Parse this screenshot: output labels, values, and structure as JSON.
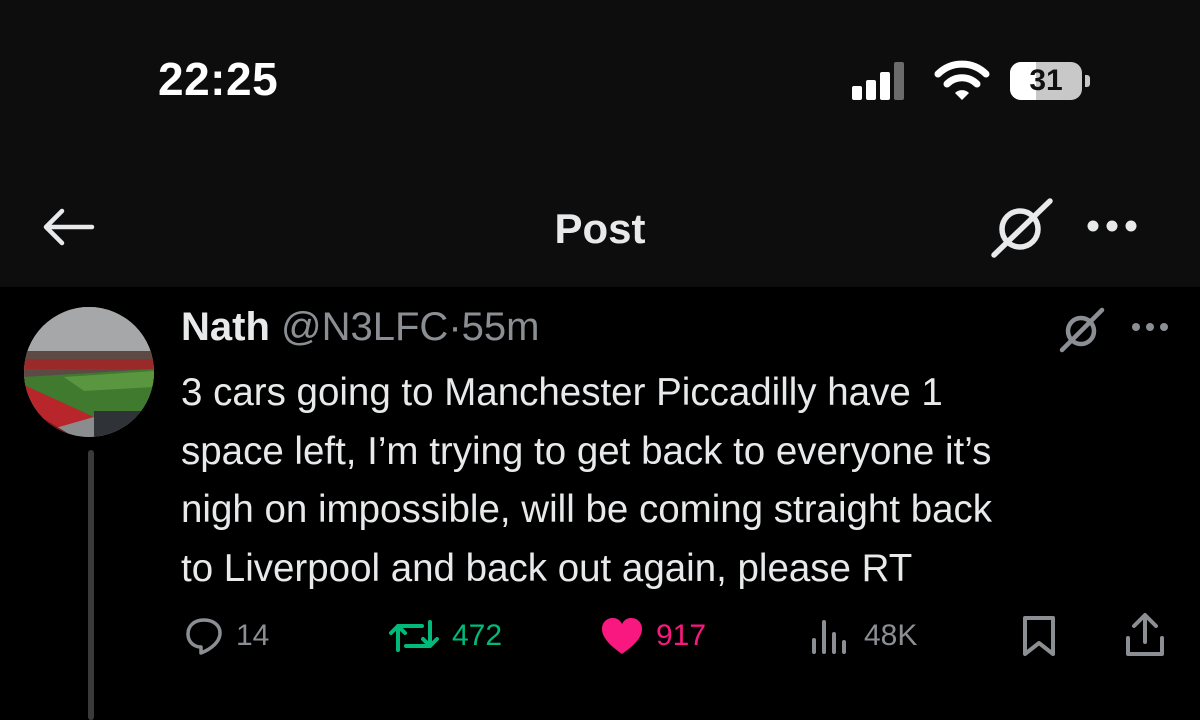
{
  "status_bar": {
    "time": "22:25",
    "battery_level": "31",
    "icons": [
      "signal-icon",
      "wifi-icon",
      "battery-icon"
    ]
  },
  "nav": {
    "title": "Post",
    "icons": [
      "back-arrow-icon",
      "grok-icon",
      "more-icon"
    ]
  },
  "tweet": {
    "author_name": "Nath",
    "author_handle": "@N3LFC",
    "separator": "·",
    "age": "55m",
    "text": "3 cars going to Manchester Piccadilly have 1\nspace left, I’m trying to get back to everyone it’s\nnigh on impossible, will be coming straight back\nto Liverpool and back out again, please RT",
    "actions": {
      "replies": "14",
      "reposts": "472",
      "likes": "917",
      "views": "48K"
    }
  },
  "colors": {
    "background": "#000000",
    "text": "#e7e9ea",
    "muted": "#8b8f94",
    "repost_active": "#00ba7c",
    "like_active": "#f91880"
  }
}
